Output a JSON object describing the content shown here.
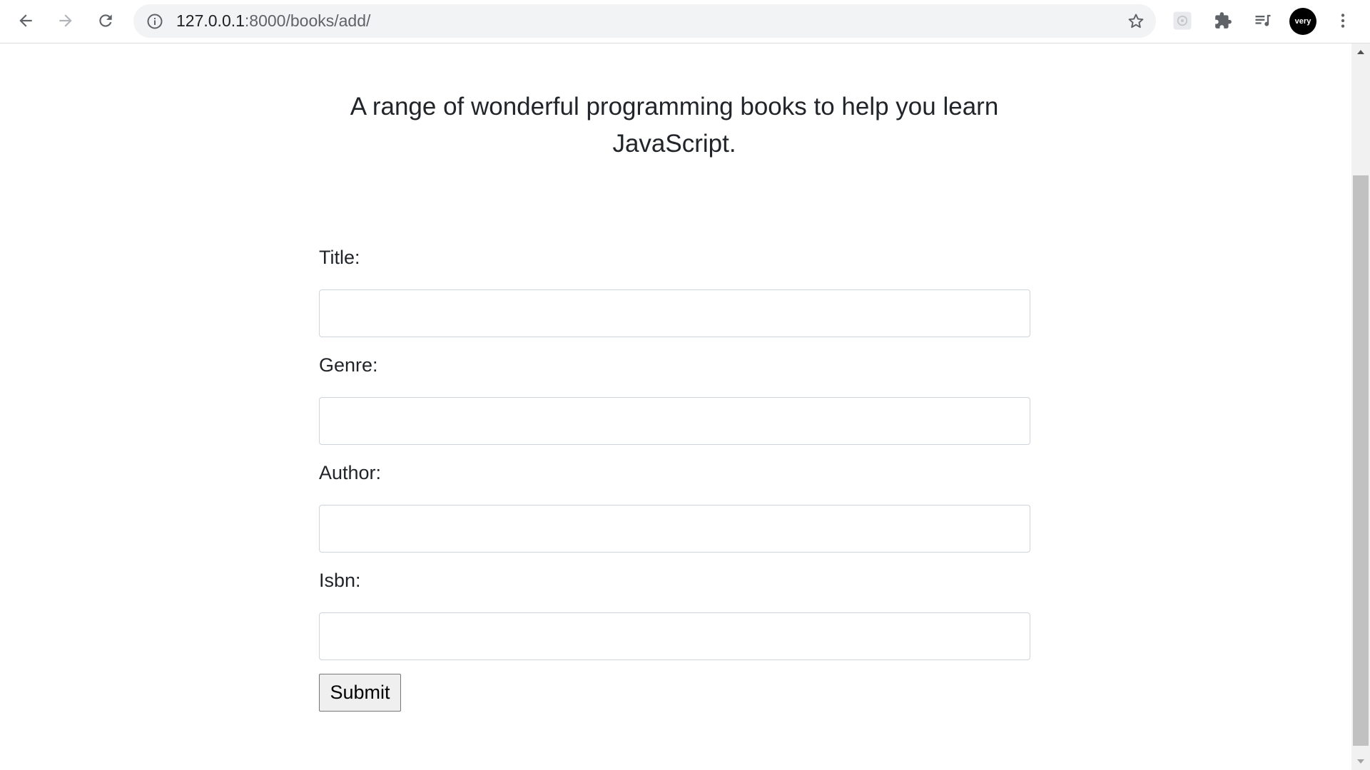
{
  "browser": {
    "url_host": "127.0.0.1",
    "url_path": ":8000/books/add/",
    "profile_label": "very",
    "icons": {
      "back": "arrow-left-icon",
      "forward": "arrow-right-icon",
      "reload": "reload-icon",
      "site_info": "info-icon",
      "bookmark": "star-icon",
      "extension_a": "extension-icon",
      "extensions": "puzzle-icon",
      "media": "playlist-icon",
      "menu": "kebab-menu-icon"
    }
  },
  "page": {
    "lead": "A range of wonderful programming books to help you learn JavaScript.",
    "form": {
      "fields": [
        {
          "label": "Title:",
          "value": ""
        },
        {
          "label": "Genre:",
          "value": ""
        },
        {
          "label": "Author:",
          "value": ""
        },
        {
          "label": "Isbn:",
          "value": ""
        }
      ],
      "submit_label": "Submit"
    }
  },
  "colors": {
    "text": "#212529",
    "input_border": "#ced4da",
    "button_bg": "#efefef"
  }
}
